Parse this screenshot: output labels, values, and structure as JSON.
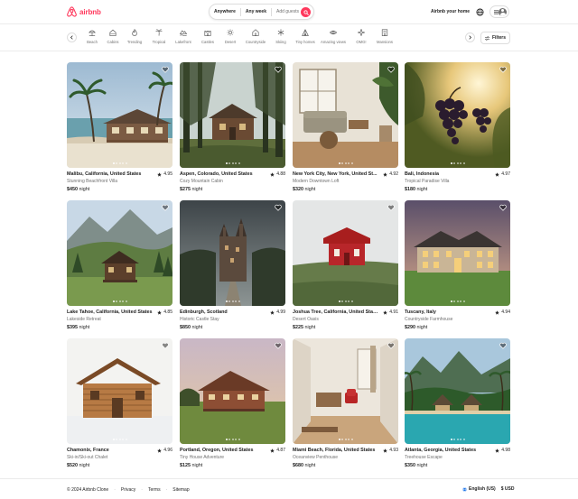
{
  "brand": {
    "name": "airbnb",
    "color": "#ff385c"
  },
  "search": {
    "where": "Anywhere",
    "when": "Any week",
    "guests": "Add guests",
    "button_icon": "search-icon"
  },
  "header": {
    "host_link": "Airbnb your home",
    "globe_icon": "globe-icon",
    "menu_icon": "hamburger-icon",
    "avatar_icon": "user-avatar-icon"
  },
  "categories": [
    {
      "label": "Beach",
      "icon": "beach-umbrella-icon"
    },
    {
      "label": "Cabins",
      "icon": "cabin-icon"
    },
    {
      "label": "Trending",
      "icon": "flame-icon"
    },
    {
      "label": "Tropical",
      "icon": "palm-tree-icon"
    },
    {
      "label": "Lakefront",
      "icon": "lake-icon"
    },
    {
      "label": "Castles",
      "icon": "castle-icon"
    },
    {
      "label": "Desert",
      "icon": "sun-icon"
    },
    {
      "label": "Countryside",
      "icon": "house-icon"
    },
    {
      "label": "Skiing",
      "icon": "snowflake-icon"
    },
    {
      "label": "Tiny homes",
      "icon": "tent-icon"
    },
    {
      "label": "Amazing views",
      "icon": "eye-icon"
    },
    {
      "label": "OMG!",
      "icon": "sparkle-icon"
    },
    {
      "label": "Mansions",
      "icon": "mansion-icon"
    }
  ],
  "filters": {
    "label": "Filters",
    "icon": "sliders-icon"
  },
  "listings": [
    {
      "location": "Malibu, California, United States",
      "rating": "4.95",
      "title": "Stunning Beachfront Villa",
      "price": "$450",
      "unit": "night",
      "scene": "beach"
    },
    {
      "location": "Aspen, Colorado, United States",
      "rating": "4.88",
      "title": "Cozy Mountain Cabin",
      "price": "$275",
      "unit": "night",
      "scene": "forest-cabin"
    },
    {
      "location": "New York City, New York, United St...",
      "rating": "4.92",
      "title": "Modern Downtown Loft",
      "price": "$320",
      "unit": "night",
      "scene": "loft"
    },
    {
      "location": "Bali, Indonesia",
      "rating": "4.97",
      "title": "Tropical Paradise Villa",
      "price": "$180",
      "unit": "night",
      "scene": "grapes"
    },
    {
      "location": "Lake Tahoe, California, United States",
      "rating": "4.85",
      "title": "Lakeside Retreat",
      "price": "$395",
      "unit": "night",
      "scene": "mountain-cabin"
    },
    {
      "location": "Edinburgh, Scotland",
      "rating": "4.99",
      "title": "Historic Castle Stay",
      "price": "$850",
      "unit": "night",
      "scene": "castle"
    },
    {
      "location": "Joshua Tree, California, United States",
      "rating": "4.91",
      "title": "Desert Oasis",
      "price": "$225",
      "unit": "night",
      "scene": "red-house"
    },
    {
      "location": "Tuscany, Italy",
      "rating": "4.94",
      "title": "Countryside Farmhouse",
      "price": "$290",
      "unit": "night",
      "scene": "mansion"
    },
    {
      "location": "Chamonix, France",
      "rating": "4.96",
      "title": "Ski-in/Ski-out Chalet",
      "price": "$520",
      "unit": "night",
      "scene": "chalet"
    },
    {
      "location": "Portland, Oregon, United States",
      "rating": "4.87",
      "title": "Tiny House Adventure",
      "price": "$125",
      "unit": "night",
      "scene": "farmhouse"
    },
    {
      "location": "Miami Beach, Florida, United States",
      "rating": "4.93",
      "title": "Oceanview Penthouse",
      "price": "$680",
      "unit": "night",
      "scene": "interior"
    },
    {
      "location": "Atlanta, Georgia, United States",
      "rating": "4.98",
      "title": "Treehouse Escape",
      "price": "$350",
      "unit": "night",
      "scene": "pool"
    }
  ],
  "footer": {
    "copyright": "© 2024 Airbnb Clone",
    "links": [
      "Privacy",
      "Terms",
      "Sitemap"
    ],
    "language": "English (US)",
    "currency": "$ USD"
  }
}
